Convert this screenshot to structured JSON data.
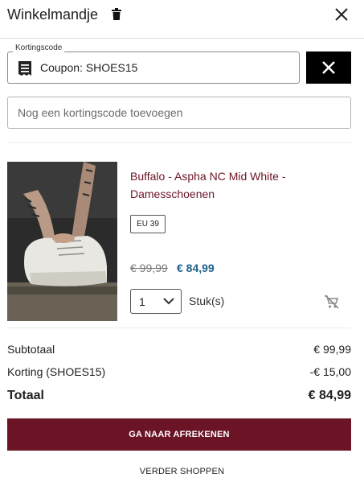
{
  "header": {
    "title": "Winkelmandje"
  },
  "coupon": {
    "legend": "Kortingscode",
    "applied_text": "Coupon: SHOES15"
  },
  "discount_input": {
    "placeholder": "Nog een kortingscode toevoegen"
  },
  "product": {
    "name": "Buffalo - Aspha NC Mid White - Damesschoenen",
    "size": "EU 39",
    "price_old": "€ 99,99",
    "price_new": "€ 84,99",
    "quantity": "1",
    "quantity_unit": "Stuk(s)"
  },
  "summary": {
    "subtotal_label": "Subtotaal",
    "subtotal_value": "€ 99,99",
    "discount_label": "Korting (SHOES15)",
    "discount_value": "-€ 15,00",
    "total_label": "Totaal",
    "total_value": "€ 84,99"
  },
  "actions": {
    "checkout_label": "GA NAAR AFREKENEN",
    "continue_label": "VERDER SHOPPEN"
  },
  "colors": {
    "brand": "#6b1425",
    "price": "#1f5f8b"
  },
  "icons": [
    "trash-icon",
    "close-icon",
    "coupon-icon",
    "chevron-down-icon",
    "remove-from-cart-icon"
  ]
}
